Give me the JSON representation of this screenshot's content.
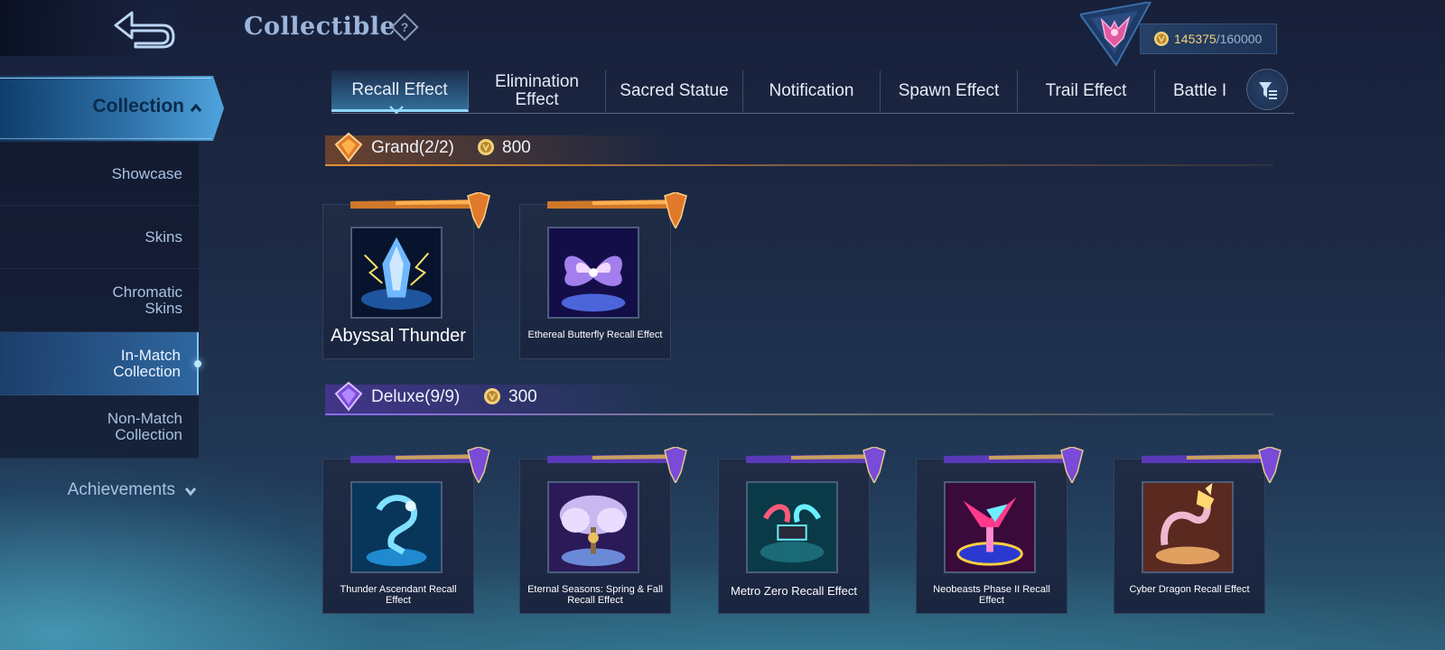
{
  "header": {
    "title": "Collectible",
    "points_current": "145375",
    "points_separator": "/",
    "points_max": "160000"
  },
  "sidebar": {
    "collection_label": "Collection",
    "items": [
      {
        "label": "Showcase",
        "active": false
      },
      {
        "label": "Skins",
        "active": false
      },
      {
        "label": "Chromatic Skins",
        "active": false
      },
      {
        "label": "In-Match Collection",
        "active": true
      },
      {
        "label": "Non-Match Collection",
        "active": false
      }
    ],
    "achievements_label": "Achievements"
  },
  "tabs": [
    {
      "label": "Recall Effect",
      "active": true
    },
    {
      "label": "Elimination Effect",
      "active": false
    },
    {
      "label": "Sacred Statue",
      "active": false
    },
    {
      "label": "Notification",
      "active": false
    },
    {
      "label": "Spawn Effect",
      "active": false
    },
    {
      "label": "Trail Effect",
      "active": false
    },
    {
      "label": "Battle I",
      "active": false
    }
  ],
  "sections": {
    "grand": {
      "label": "Grand(2/2)",
      "cost": "800",
      "accent": "#f0a040",
      "items": [
        {
          "name": "Abyssal Thunder",
          "icon": "abyssal-thunder-art"
        },
        {
          "name": "Ethereal Butterfly Recall Effect",
          "icon": "ethereal-butterfly-art"
        }
      ]
    },
    "deluxe": {
      "label": "Deluxe(9/9)",
      "cost": "300",
      "accent": "#9a6cf0",
      "items": [
        {
          "name": "Thunder Ascendant Recall Effect",
          "icon": "thunder-ascendant-art"
        },
        {
          "name": "Eternal Seasons: Spring & Fall Recall Effect",
          "icon": "eternal-seasons-art"
        },
        {
          "name": "Metro Zero Recall Effect",
          "icon": "metro-zero-art"
        },
        {
          "name": "Neobeasts Phase II Recall Effect",
          "icon": "neobeasts-art"
        },
        {
          "name": "Cyber Dragon Recall Effect",
          "icon": "cyber-dragon-art"
        }
      ]
    }
  }
}
